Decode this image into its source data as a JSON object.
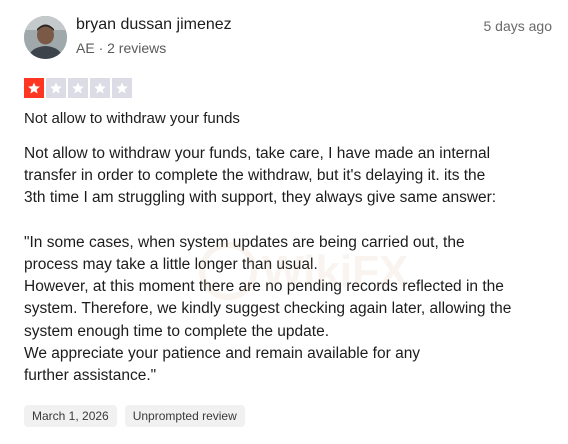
{
  "reviewer": {
    "name": "bryan dussan jimenez",
    "meta": "AE · 2 reviews",
    "time_ago": "5 days ago"
  },
  "rating": {
    "value": 1,
    "max": 5,
    "filled_color": "#ff3722",
    "empty_color": "#dcdce6",
    "icon": "star-icon"
  },
  "review": {
    "title": "Not allow to withdraw your funds",
    "paragraphs": [
      "Not allow to withdraw your funds, take care, I have made an internal\ntransfer in order to complete the withdraw, but it's delaying it. its the\n3th time I am struggling with support, they always give same answer:",
      "\"In some cases, when system updates are being carried out, the\nprocess may take a little longer than usual.\nHowever, at this moment there are no pending records reflected in the\nsystem. Therefore, we kindly suggest checking again later, allowing the\nsystem enough time to complete the update.\nWe appreciate your patience and remain available for any\nfurther assistance.\""
    ]
  },
  "tags": {
    "date": "March 1, 2026",
    "type": "Unprompted review"
  },
  "watermark": {
    "text": "WikiFX",
    "color": "#c9a06a"
  }
}
